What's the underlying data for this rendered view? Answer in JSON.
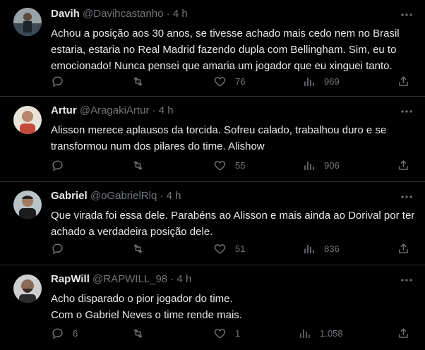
{
  "tweets": [
    {
      "name": "Davih",
      "handle": "@Davihcastanho",
      "dot": "·",
      "time": "4 h",
      "lines": [
        "Achou a posição aos 30 anos, se tivesse achado mais cedo nem no Brasil",
        "estaria, estaria no Real Madrid fazendo dupla com Bellingham. Sim, eu to",
        "emocionado! Nunca pensei que amaria um jogador que eu xinguei tanto."
      ],
      "replies": "",
      "retweets": "",
      "likes": "76",
      "views": "969"
    },
    {
      "name": "Artur",
      "handle": "@AragakiArtur",
      "dot": "·",
      "time": "4 h",
      "lines": [
        "Alisson merece aplausos da torcida. Sofreu calado, trabalhou duro e se",
        "transformou num dos pilares do time. Alishow"
      ],
      "replies": "",
      "retweets": "",
      "likes": "55",
      "views": "906"
    },
    {
      "name": "Gabriel",
      "handle": "@oGabrielRlq",
      "dot": "·",
      "time": "4 h",
      "lines": [
        "Que virada foi essa dele. Parabéns ao Alisson e mais ainda ao Dorival por ter",
        "achado a verdadeira posição dele."
      ],
      "replies": "",
      "retweets": "",
      "likes": "51",
      "views": "836"
    },
    {
      "name": "RapWill",
      "handle": "@RAPWILL_98",
      "dot": "·",
      "time": "4 h",
      "lines": [
        "Acho disparado o pior jogador do time.",
        "Com o Gabriel Neves o time rende mais."
      ],
      "replies": "6",
      "retweets": "",
      "likes": "1",
      "views": "1.058"
    }
  ],
  "icons": {
    "reply": "reply-icon",
    "retweet": "retweet-icon",
    "like": "heart-icon",
    "views": "views-chart-icon",
    "share": "share-icon",
    "more": "more-horizontal-icon"
  },
  "colors": {
    "background": "#000000",
    "text": "#e7e9ea",
    "muted": "#71767b",
    "divider": "#2f3336"
  }
}
